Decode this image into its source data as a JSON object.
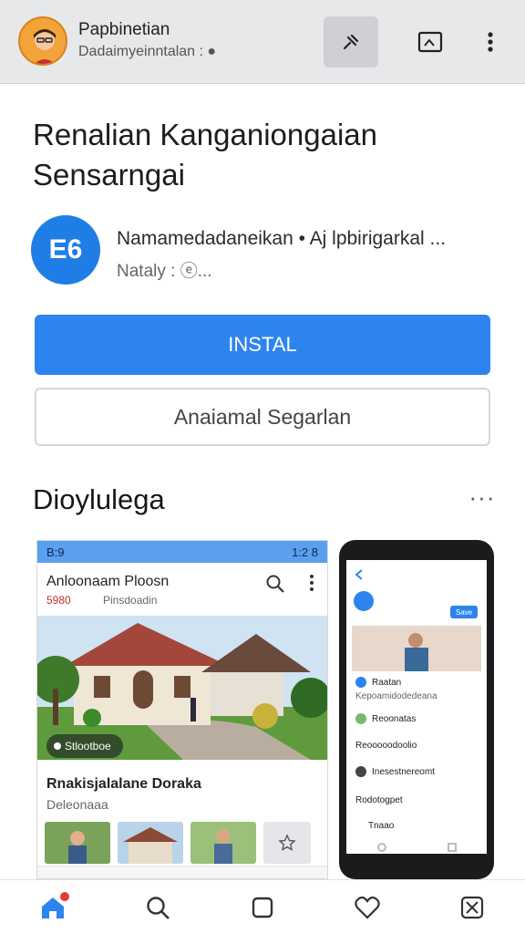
{
  "topbar": {
    "title": "Papbinetian",
    "subtitle": "Dadaimyeinntalan : ●"
  },
  "app": {
    "title": "Renalian Kanganiongaian Sensarngai",
    "icon_text": "E6",
    "developer": "Namamedadaneikan • Aj lpbirigarkal ...",
    "meta": "Nataly : ⓔ...",
    "install_label": "INSTAL",
    "secondary_label": "Anaiamal Segarlan"
  },
  "section": {
    "title": "Dioylulega",
    "more": "···"
  },
  "shot1": {
    "time": "B:9",
    "status_right": "1:2 8",
    "title": "Anloonaam Ploosn",
    "tag": "5980",
    "sub": "Pinsdoadin",
    "chip": "Stlootboe",
    "caption": "Rnakisjalalane Doraka",
    "caption_sub": "Deleonaaa"
  },
  "shot2": {
    "rows": [
      "Raatan",
      "Kepoamidodedeana",
      "Reoonatas",
      "Reooooodoolio",
      "Inesestnereomt",
      "Rodotogpet",
      "Tnaao"
    ],
    "action": "Save"
  },
  "colors": {
    "accent": "#2d84ee",
    "topbar": "#e7e8ea",
    "badge": "#e53935"
  }
}
